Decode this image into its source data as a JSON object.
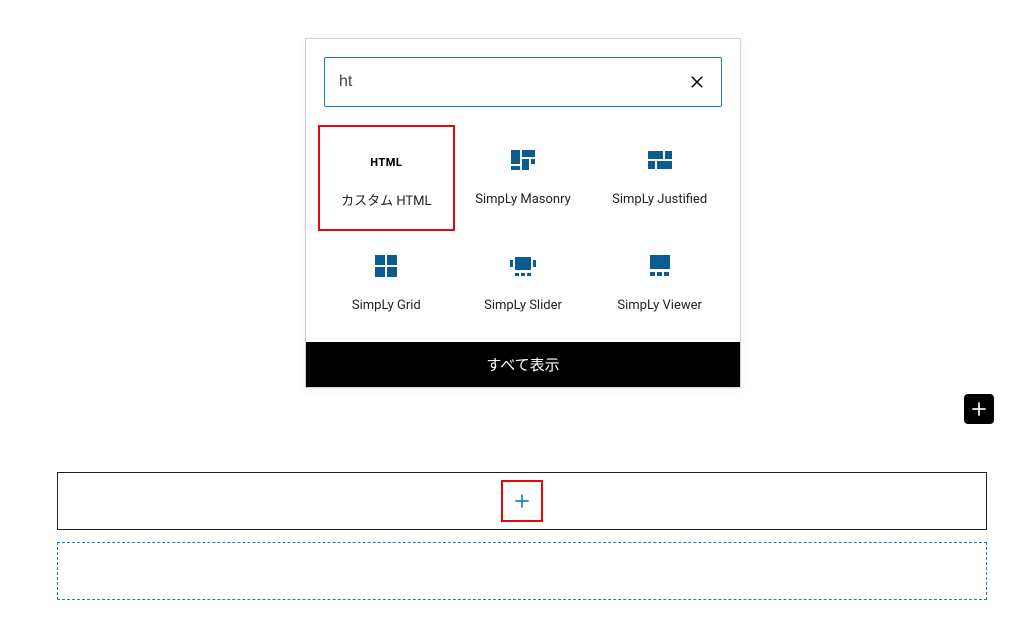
{
  "search": {
    "value": "ht",
    "placeholder": ""
  },
  "blocks": [
    {
      "label": "カスタム HTML",
      "icon": "html"
    },
    {
      "label": "SimpLy Masonry",
      "icon": "masonry"
    },
    {
      "label": "SimpLy Justified",
      "icon": "justified"
    },
    {
      "label": "SimpLy Grid",
      "icon": "grid"
    },
    {
      "label": "SimpLy Slider",
      "icon": "slider"
    },
    {
      "label": "SimpLy Viewer",
      "icon": "viewer"
    }
  ],
  "footer": {
    "browse_all": "すべて表示"
  }
}
